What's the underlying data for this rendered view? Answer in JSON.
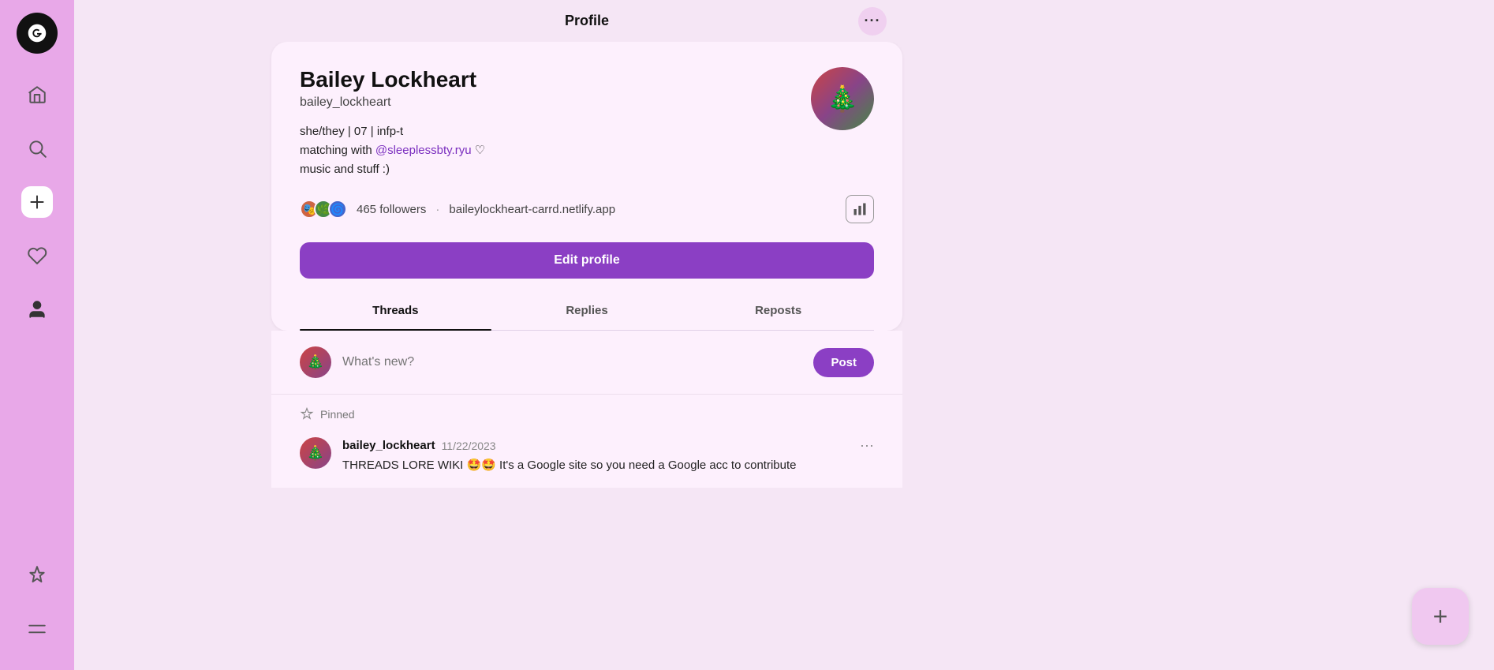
{
  "app": {
    "logo_label": "Threads App Logo"
  },
  "sidebar": {
    "nav_items": [
      {
        "name": "home",
        "icon": "home"
      },
      {
        "name": "search",
        "icon": "search"
      },
      {
        "name": "create",
        "icon": "plus"
      },
      {
        "name": "activity",
        "icon": "heart"
      },
      {
        "name": "profile",
        "icon": "person"
      }
    ],
    "bottom_items": [
      {
        "name": "pin",
        "icon": "pin"
      },
      {
        "name": "menu",
        "icon": "menu"
      }
    ]
  },
  "header": {
    "title": "Profile",
    "menu_label": "···"
  },
  "profile": {
    "name": "Bailey Lockheart",
    "handle": "bailey_lockheart",
    "bio_line1": "she/they | 07 | infp-t",
    "bio_line2_prefix": "matching with ",
    "bio_mention": "@sleeplessbty.ryu",
    "bio_line2_suffix": " ♡",
    "bio_line3": "music and stuff :)",
    "followers_count": "465 followers",
    "separator": "·",
    "website": "baileylockheart-carrd.netlify.app",
    "edit_button_label": "Edit profile"
  },
  "tabs": {
    "threads": "Threads",
    "replies": "Replies",
    "reposts": "Reposts",
    "active": "threads"
  },
  "new_thread": {
    "placeholder": "What's new?",
    "post_button": "Post"
  },
  "pinned_post": {
    "label": "Pinned",
    "username": "bailey_lockheart",
    "date": "11/22/2023",
    "text": "THREADS LORE WIKI 🤩🤩 It's a Google site so you need a Google acc to contribute"
  }
}
